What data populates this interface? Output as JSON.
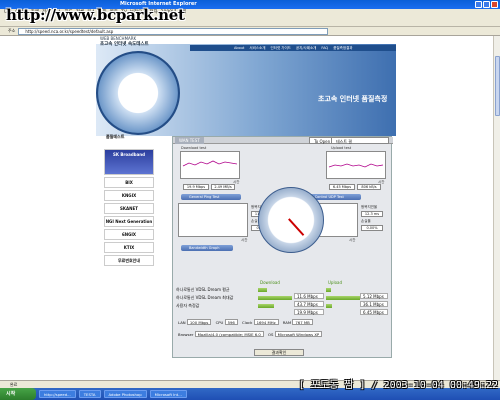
{
  "window": {
    "title": "Microsoft Internet Explorer"
  },
  "watermark": "http://www.bcpark.net",
  "menubar": [
    "다음",
    "이메일",
    "카페",
    "검색",
    "뉴스",
    "지도",
    "전체",
    "북스",
    "쇼핑",
    "영화",
    "TV",
    "브라우저",
    "전자",
    "2009년 시계"
  ],
  "address": {
    "label": "주소",
    "url": "http://speed.nca.or.kr/speedtest/default.asp"
  },
  "header": {
    "brand_top": "WEB BENCHMARK",
    "brand_title": "초고속 인터넷 속도테스트",
    "nav": [
      "About",
      "서비스소개",
      "인터넷 가이드",
      "공지/사례소개",
      "FAQ",
      "품질측정결과"
    ],
    "banner": "초고속 인터넷 품질측정"
  },
  "sidebar": {
    "title": "품질테스트",
    "logos": [
      "SK Broadband",
      "BIX",
      "KNGIX",
      "SKANET",
      "NGI Next Generation",
      "6NGIX",
      "KTIX",
      "무료번호안내"
    ]
  },
  "panel": {
    "tab_active": "WAN TEST",
    "tab_option": "To Open",
    "tab_extra": "테스트 결",
    "download": {
      "label": "Download test",
      "value": "19.9 Mbps",
      "value2": "2.49 MB/s",
      "xlabel": "시간"
    },
    "upload": {
      "label": "Upload test",
      "value": "6.45 Mbps",
      "value2": "806 kB/s",
      "xlabel": "시간"
    },
    "general_ping": "General Ping Test",
    "network_control": "Network Control UDP Test",
    "ping_left": {
      "loss_label": "왕복지연율",
      "loss_value": "11.9 ms",
      "rate_label": "손실율",
      "rate_value": "0.00%",
      "xlabel": "시간"
    },
    "ping_right": {
      "loss_label": "왕복지연율",
      "loss_value": "12.3 ms",
      "rate_label": "손실율",
      "rate_value": "0.00%",
      "xlabel": "시간"
    },
    "bandwidth_graph": "Bandwidth Graph",
    "results_header": {
      "download": "Download",
      "upload": "Upload"
    },
    "results": [
      {
        "label": "하나로통신 VDSL Dream 평균",
        "down": "11.6 Mbps",
        "down_frac": 0.27,
        "up": "5.12 Mbps",
        "up_frac": 0.14
      },
      {
        "label": "하나로통신 VDSL Dream 최대값",
        "down": "43.7 Mbps",
        "down_frac": 1.0,
        "up": "36.1 Mbps",
        "up_frac": 1.0
      },
      {
        "label": "사용자 측정값",
        "down": "19.9 Mbps",
        "down_frac": 0.46,
        "up": "6.45 Mbps",
        "up_frac": 0.18
      }
    ],
    "system": {
      "lan_label": "LAN",
      "lan": "100 Mbps",
      "cpu_label": "CPU",
      "cpu": "596",
      "clock_label": "Clock",
      "clock": "1694 MHz",
      "ram_label": "RAM",
      "ram": "767 MB",
      "browser_label": "Browser",
      "browser": "Mozilla/4.0 (compatible; MSIE 6.0",
      "os_label": "OS",
      "os": "Microsoft Windows XP"
    },
    "result_button": "결과확인"
  },
  "status": {
    "text": "완료"
  },
  "taskbar": {
    "start": "시작",
    "tasks": [
      "http://speed...",
      "TESTA",
      "Adobe Photoshop",
      "Microsoft Int..."
    ],
    "clock": "[ 포도동 짬 ] / 2003-10-04 00:49:22"
  }
}
